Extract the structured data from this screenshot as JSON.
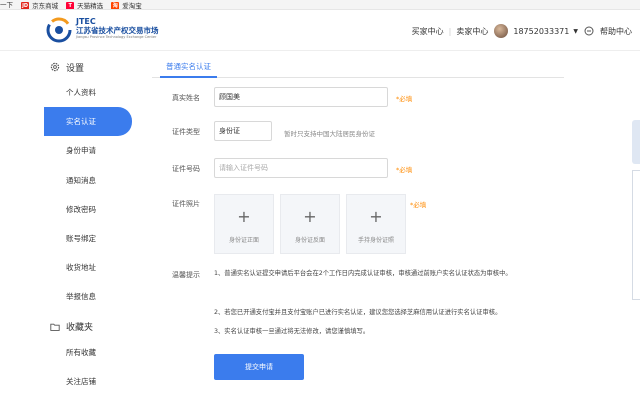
{
  "bookmarks": [
    {
      "label": "一下",
      "icon_text": "",
      "color": ""
    },
    {
      "label": "京东商城",
      "icon_text": "JD",
      "color": "#e1251b"
    },
    {
      "label": "天猫精选",
      "icon_text": "T",
      "color": "#ff0036"
    },
    {
      "label": "爱淘宝",
      "icon_text": "淘",
      "color": "#ff4400"
    }
  ],
  "logo": {
    "en": "JTEC",
    "cn": "江苏省技术产权交易市场",
    "sub": "Jiangsu Province Technology Exchange Center"
  },
  "header_nav": {
    "buyer": "买家中心",
    "seller": "卖家中心",
    "phone": "18752033371",
    "help": "帮助中心"
  },
  "sidebar": {
    "settings_group": "设置",
    "settings_items": [
      "个人资料",
      "实名认证",
      "身份申请",
      "通知消息",
      "修改密码",
      "账号绑定",
      "收货地址",
      "举报信息"
    ],
    "active_index": 1,
    "favorites_group": "收藏夹",
    "favorites_items": [
      "所有收藏",
      "关注店铺"
    ]
  },
  "main": {
    "tab": "普通实名认证",
    "name_label": "真实姓名",
    "name_value": "顾国美",
    "required": "*必填",
    "id_type_label": "证件类型",
    "id_type_value": "身份证",
    "id_type_note": "暂时只支持中国大陆居民身份证",
    "id_number_label": "证件号码",
    "id_number_placeholder": "请输入证件号码",
    "photo_label": "证件照片",
    "photos": [
      "身份证正面",
      "身份证反面",
      "手持身份证照"
    ],
    "tips_label": "温馨提示",
    "tips": [
      "1、普通实名认证提交申请后平台会在2个工作日内完成认证审核，审核通过前账户实名认证状态为审核中。",
      "2、若您已开通支付宝并且支付宝账户已进行实名认证，建议您您选择芝麻信用认证进行实名认证审核。",
      "3、实名认证审核一旦通过将无法修改，请您谨慎填写。"
    ],
    "submit": "提交申请"
  }
}
